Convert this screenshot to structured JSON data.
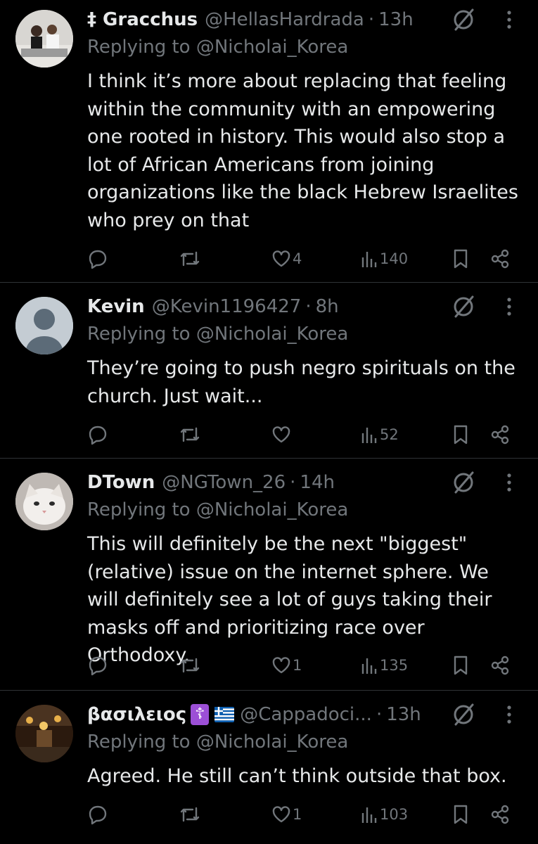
{
  "replies": [
    {
      "name": "‡ Gracchus",
      "handle": "@HellasHardrada",
      "dot": "·",
      "time": "13h",
      "replying_label": "Replying to",
      "replying_to": "@Nicholai_Korea",
      "text": "I think it’s more about replacing that feeling within the community with an empowering one rooted in history. This would also stop a lot of African Americans from joining organizations like the black Hebrew Israelites who prey on that",
      "likes": "4",
      "views": "140",
      "avatar": "photo-couple"
    },
    {
      "name": "Kevin",
      "handle": "@Kevin1196427",
      "dot": "·",
      "time": "8h",
      "replying_label": "Replying to",
      "replying_to": "@Nicholai_Korea",
      "text": "They’re going to push negro spirituals on the church. Just wait...",
      "likes": "",
      "views": "52",
      "avatar": "default-avatar"
    },
    {
      "name": "DTown",
      "handle": "@NGTown_26",
      "dot": "·",
      "time": "14h",
      "replying_label": "Replying to",
      "replying_to": "@Nicholai_Korea",
      "text": "This will definitely be the next \"biggest\" (relative) issue on the internet sphere. We will definitely see a lot of guys taking their masks off and prioritizing race over Orthodoxy.",
      "likes": "1",
      "views": "135",
      "avatar": "cat-photo"
    },
    {
      "name": "βασιλειος",
      "name_emoji": "☦",
      "handle": "@Cappadoci...",
      "dot": "·",
      "time": "13h",
      "replying_label": "Replying to",
      "replying_to": "@Nicholai_Korea",
      "text": "Agreed. He still can’t think outside that box.",
      "likes": "1",
      "views": "103",
      "avatar": "church-interior"
    }
  ],
  "colors": {
    "background": "#000000",
    "text": "#e7e9ea",
    "muted": "#71767b",
    "divider": "#2f3336",
    "orthodox_badge": "#9c4fd6",
    "greek_flag_blue": "#0d5eaf"
  },
  "icons": [
    "reply-icon",
    "retweet-icon",
    "like-icon",
    "views-icon",
    "bookmark-icon",
    "share-icon",
    "grok-icon",
    "more-icon"
  ]
}
